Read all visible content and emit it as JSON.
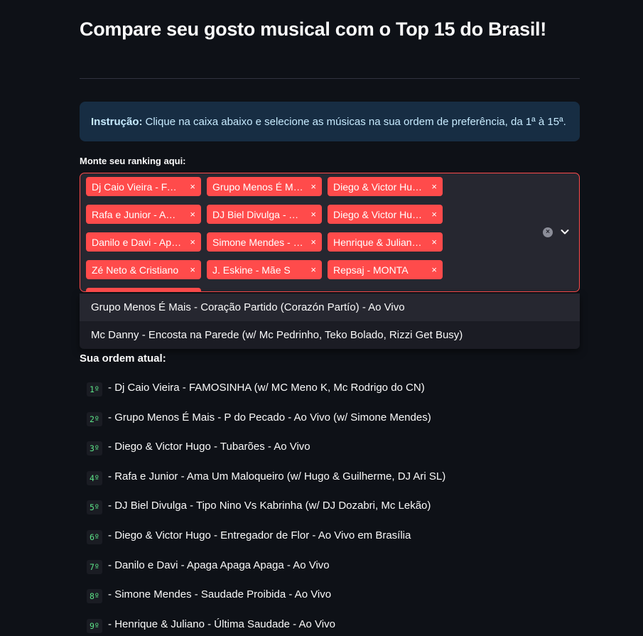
{
  "header": {
    "title": "Compare seu gosto musical com o Top 15 do Brasil!"
  },
  "info": {
    "label": "Instrução:",
    "text": "Clique na caixa abaixo e selecione as músicas na sua ordem de preferência, da 1ª à 15ª."
  },
  "ranking_input": {
    "label": "Monte seu ranking aqui:",
    "remove_glyph": "×",
    "clear_glyph": "×",
    "tags": [
      "Dj Caio Vieira - FAMOSINHA (w/ MC Meno K, Mc Rodrigo do CN)",
      "Grupo Menos É Mais - P do Pecado - Ao Vivo (w/ Simone Mendes)",
      "Diego & Victor Hugo - Tubarões - Ao Vivo",
      "Rafa e Junior - Ama Um Maloqueiro (w/ Hugo & Guilherme, DJ Ari SL)",
      "DJ Biel Divulga - Tipo Nino Vs Kabrinha (w/ DJ Dozabri, Mc Lekão)",
      "Diego & Victor Hugo - Entregador de Flor - Ao Vivo em Brasília",
      "Danilo e Davi - Apaga Apaga Apaga - Ao Vivo",
      "Simone Mendes - Saudade Proibida - Ao Vivo",
      "Henrique & Juliano - Última Saudade - Ao Vivo",
      "Zé Neto & Cristiano",
      "J. Eskine - Mãe S",
      "Repsaj - MONTA",
      ""
    ]
  },
  "dropdown": {
    "options": [
      "Grupo Menos É Mais - Coração Partido (Corazón Partío) - Ao Vivo",
      "Mc Danny - Encosta na Parede (w/ Mc Pedrinho, Teko Bolado, Rizzi Get Busy)"
    ]
  },
  "order": {
    "heading": "Sua ordem atual:",
    "separator": " - ",
    "items": [
      {
        "rank": "1º",
        "text": "Dj Caio Vieira - FAMOSINHA (w/ MC Meno K, Mc Rodrigo do CN)"
      },
      {
        "rank": "2º",
        "text": "Grupo Menos É Mais - P do Pecado - Ao Vivo (w/ Simone Mendes)"
      },
      {
        "rank": "3º",
        "text": "Diego & Victor Hugo - Tubarões - Ao Vivo"
      },
      {
        "rank": "4º",
        "text": "Rafa e Junior - Ama Um Maloqueiro (w/ Hugo & Guilherme, DJ Ari SL)"
      },
      {
        "rank": "5º",
        "text": "DJ Biel Divulga - Tipo Nino Vs Kabrinha (w/ DJ Dozabri, Mc Lekão)"
      },
      {
        "rank": "6º",
        "text": "Diego & Victor Hugo - Entregador de Flor - Ao Vivo em Brasília"
      },
      {
        "rank": "7º",
        "text": "Danilo e Davi - Apaga Apaga Apaga - Ao Vivo"
      },
      {
        "rank": "8º",
        "text": "Simone Mendes - Saudade Proibida - Ao Vivo"
      },
      {
        "rank": "9º",
        "text": "Henrique & Juliano - Última Saudade - Ao Vivo"
      }
    ]
  },
  "colors": {
    "background": "#0e1117",
    "accent": "#ff4b4b",
    "info_bg": "#172d43",
    "info_text": "#c7ebff",
    "rank_code": "#5ce488"
  }
}
